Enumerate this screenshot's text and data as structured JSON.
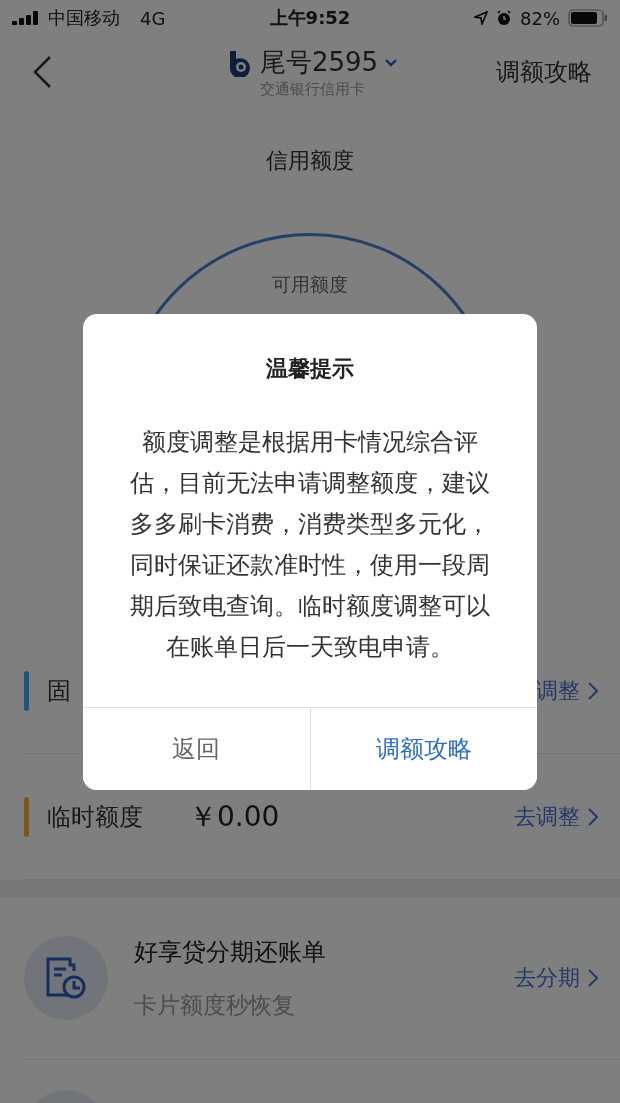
{
  "status_bar": {
    "carrier": "中国移动",
    "network": "4G",
    "time": "上午9:52",
    "battery": "82%"
  },
  "header": {
    "card": "尾号2595",
    "bank": "交通银行信用卡",
    "action": "调额攻略"
  },
  "title": "信用额度",
  "gauge": {
    "label": "可用额度"
  },
  "limits": [
    {
      "label": "固",
      "action": "调整",
      "color": "#1a567e"
    },
    {
      "label": "临时额度",
      "amount": "￥0.00",
      "action": "去调整",
      "color": "#7f5716"
    }
  ],
  "promo": {
    "title": "好享贷分期还账单",
    "subtitle": "卡片额度秒恢复",
    "action": "去分期"
  },
  "dialog": {
    "title": "温馨提示",
    "message": "额度调整是根据用卡情况综合评估，目前无法申请调整额度，建议多多刷卡消费，消费类型多元化，同时保证还款准时性，使用一段周期后致电查询。临时额度调整可以在账单日后一天致电申请。",
    "buttons": [
      {
        "label": "返回",
        "kind": "cancel"
      },
      {
        "label": "调额攻略",
        "kind": "primary"
      }
    ]
  }
}
